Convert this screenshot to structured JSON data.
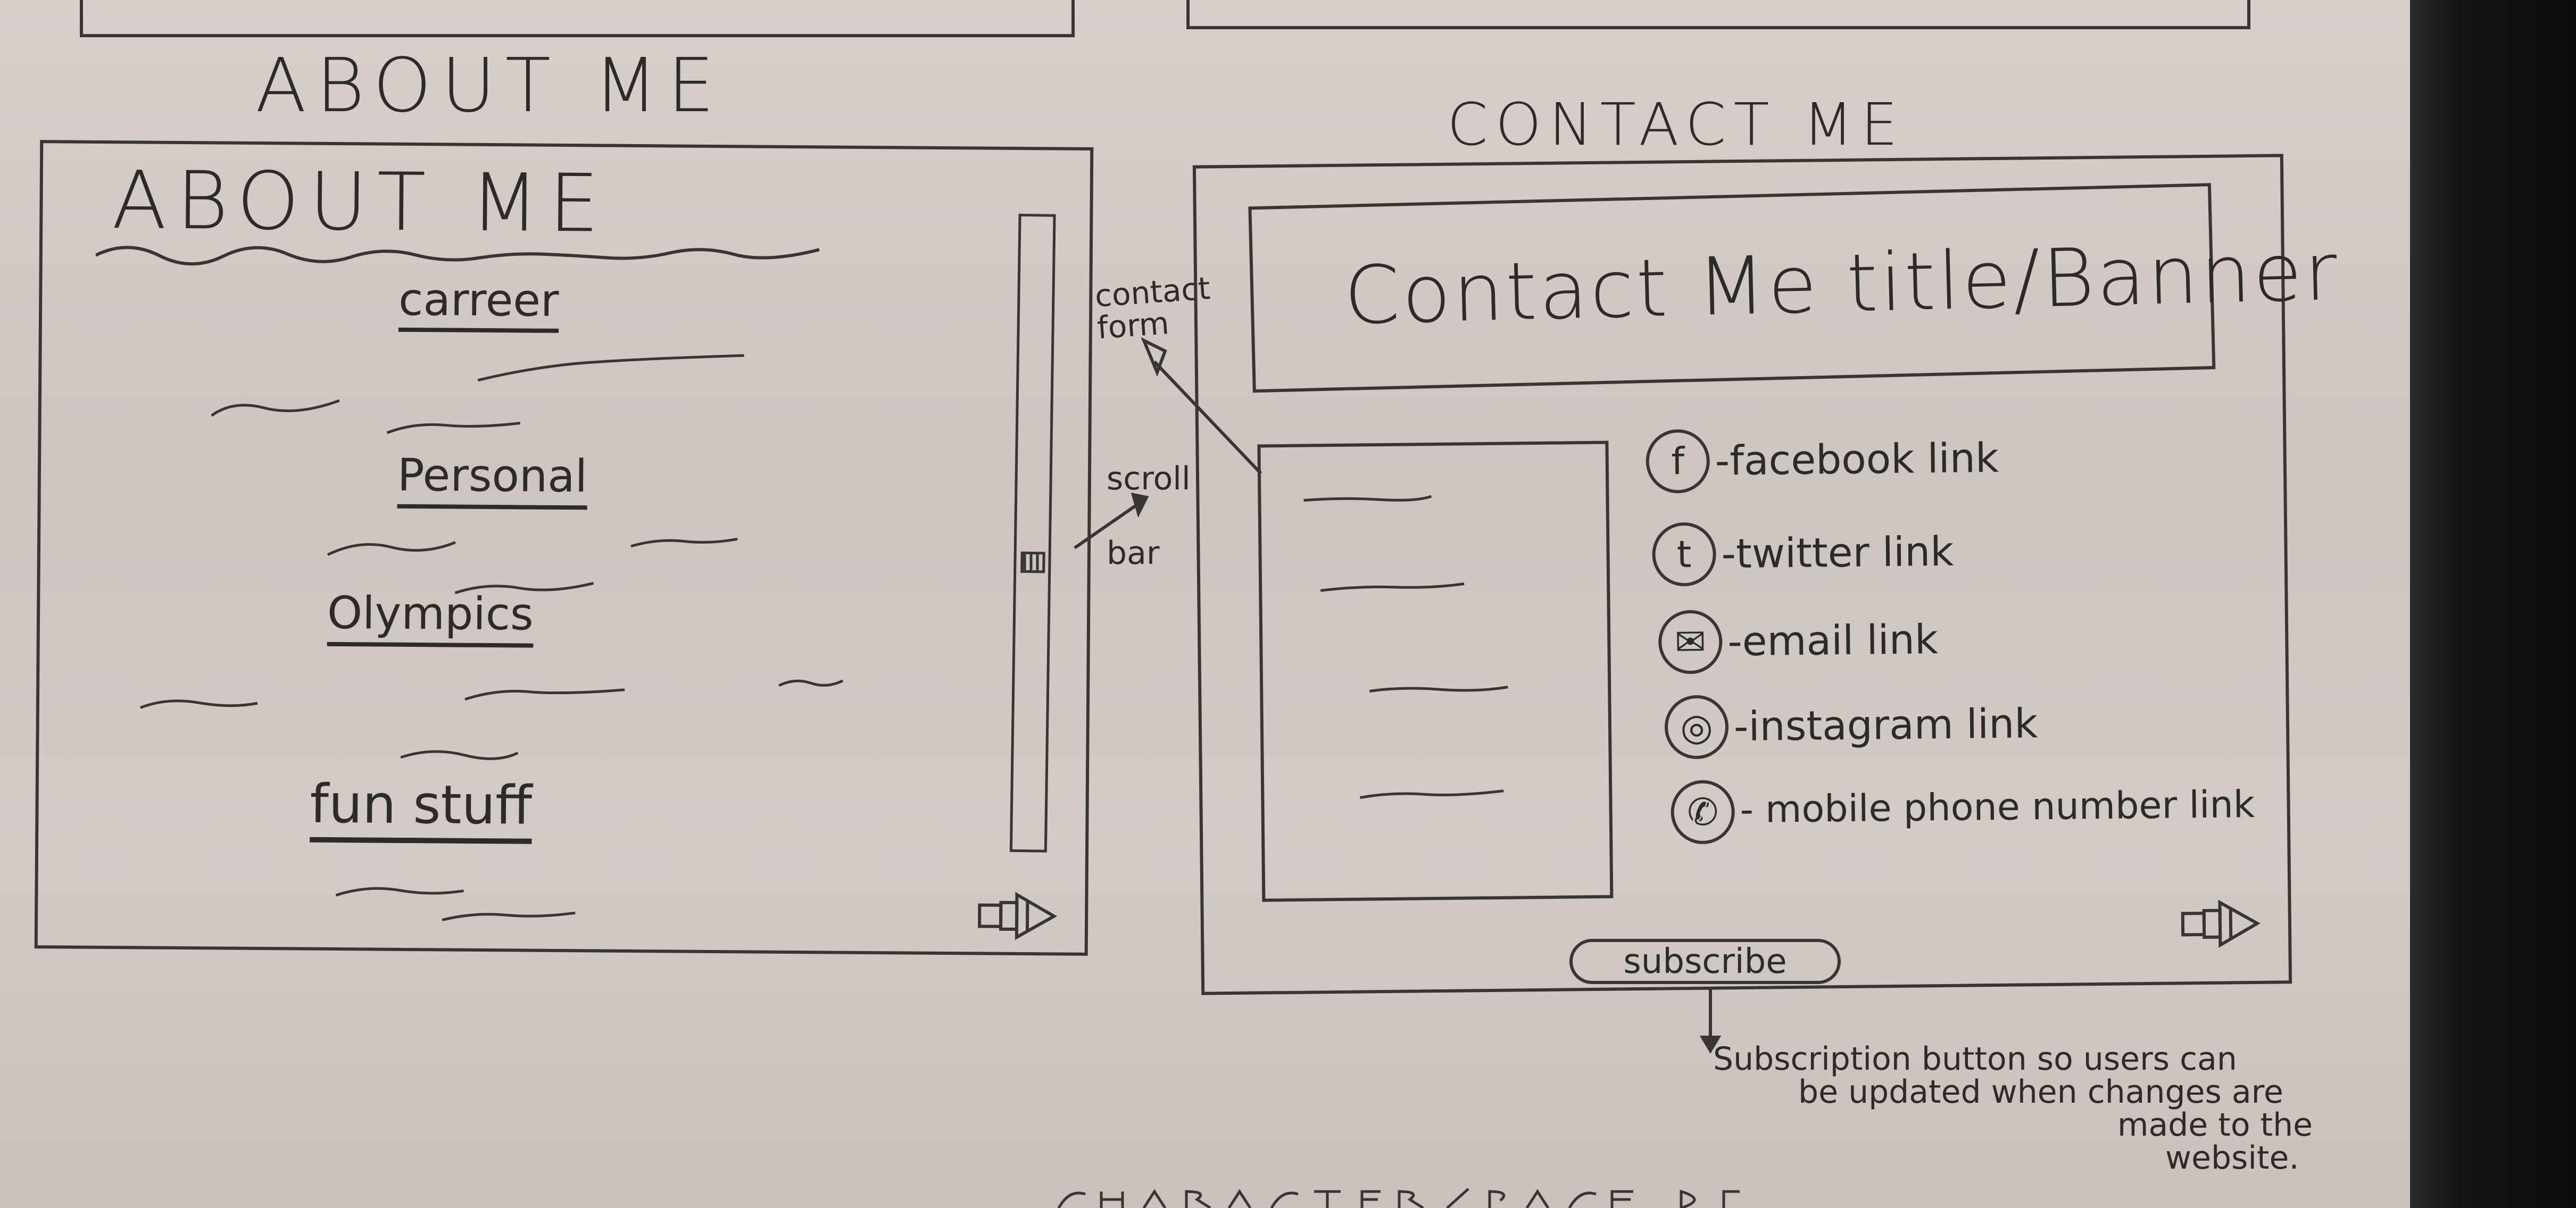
{
  "about_section": {
    "caption": "ABOUT ME",
    "box_title": "ABOUT ME",
    "links": [
      "carreer",
      "Personal",
      "Olympics",
      "fun stuff"
    ]
  },
  "annotations": {
    "contact_form": "contact form",
    "scroll_bar": "scroll bar",
    "subscribe_note": [
      "Subscription button so users can",
      "be updated when changes are",
      "made to the",
      "website."
    ]
  },
  "contact_section": {
    "caption": "CONTACT ME",
    "banner": "Contact Me title/Banner",
    "social": [
      {
        "glyph": "f",
        "icon": "facebook-icon",
        "label": "-facebook link"
      },
      {
        "glyph": "t",
        "icon": "twitter-icon",
        "label": "-twitter link"
      },
      {
        "glyph": "✉",
        "icon": "email-icon",
        "label": "-email link"
      },
      {
        "glyph": "◎",
        "icon": "instagram-icon",
        "label": "-instagram link"
      },
      {
        "glyph": "✆",
        "icon": "phone-icon",
        "label": "- mobile phone number link"
      }
    ],
    "subscribe_label": "subscribe"
  }
}
